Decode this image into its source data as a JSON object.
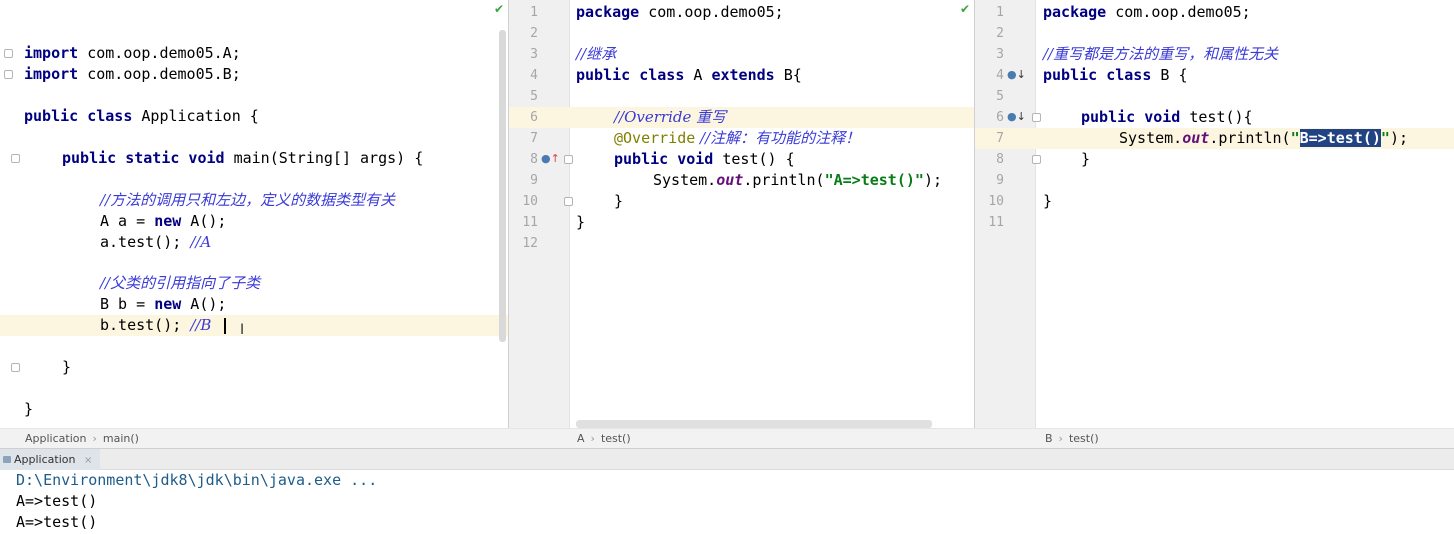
{
  "editors": {
    "application": {
      "lines": {
        "imp1_kw": "import",
        "imp1_rest": " com.oop.demo05.A;",
        "imp2_kw": "import",
        "imp2_rest": " com.oop.demo05.B;",
        "cls_kw": "public class",
        "cls_rest": " Application {",
        "main_kw": "public static void",
        "main_rest": " main(String[] args) {",
        "cmt1": "//方法的调用只和左边，定义的数据类型有关",
        "a_decl_pre": "A a = ",
        "a_decl_kw": "new",
        "a_decl_post": " A();",
        "a_call": "a.test(); ",
        "a_call_cmt": "//A",
        "cmt2": "//父类的引用指向了子类",
        "b_decl_pre": "B b = ",
        "b_decl_kw": "new",
        "b_decl_post": " A();",
        "b_call": "b.test(); ",
        "b_call_cmt": "//B",
        "close_method": "}",
        "close_class": "}"
      },
      "breadcrumb": [
        "Application",
        "main()"
      ]
    },
    "class_a": {
      "line_numbers": [
        "1",
        "2",
        "3",
        "4",
        "5",
        "6",
        "7",
        "8",
        "9",
        "10",
        "11",
        "12"
      ],
      "lines": {
        "pkg_kw": "package",
        "pkg_rest": " com.oop.demo05;",
        "cmt_inherit": "//继承",
        "cls_kw1": "public class",
        "cls_name": " A ",
        "cls_kw2": "extends",
        "cls_rest": " B{",
        "cmt_override": "//Override 重写",
        "ann": "@Override",
        "ann_cmt": " //注解：有功能的注释！",
        "m_kw": "public void",
        "m_rest": " test() {",
        "print_pre": "System.",
        "print_out": "out",
        "print_mid": ".println(",
        "print_str": "\"A=>test()\"",
        "print_end": ");",
        "close_method": "}",
        "close_class": "}"
      },
      "breadcrumb": [
        "A",
        "test()"
      ]
    },
    "class_b": {
      "line_numbers": [
        "1",
        "2",
        "3",
        "4",
        "5",
        "6",
        "7",
        "8",
        "9",
        "10",
        "11"
      ],
      "lines": {
        "pkg_kw": "package",
        "pkg_rest": " com.oop.demo05;",
        "cmt": "//重写都是方法的重写，和属性无关",
        "cls_kw": "public class",
        "cls_rest": " B {",
        "m_kw": "public void",
        "m_rest": " test(){",
        "print_pre": "System.",
        "print_out": "out",
        "print_mid": ".println(",
        "print_q1": "\"",
        "print_sel": "B=>test()",
        "print_q2": "\"",
        "print_end": ");",
        "close_method": "}",
        "close_class": "}"
      },
      "breadcrumb": [
        "B",
        "test()"
      ]
    }
  },
  "run_panel": {
    "tab_label": "Application",
    "tab_close": "×",
    "output": [
      "D:\\Environment\\jdk8\\jdk\\bin\\java.exe ...",
      "A=>test()",
      "A=>test()"
    ]
  },
  "icons": {
    "inspection_ok": "check-icon",
    "overriding_method": "override-up-icon",
    "overridden_method": "overridden-down-icon",
    "text_cursor": "ibeam-cursor-icon"
  },
  "colors": {
    "keyword": "#000080",
    "comment": "#3a3ad6",
    "string": "#067d17",
    "annotation": "#808000",
    "current_line": "#fcf6e1",
    "selection": "#214283"
  }
}
